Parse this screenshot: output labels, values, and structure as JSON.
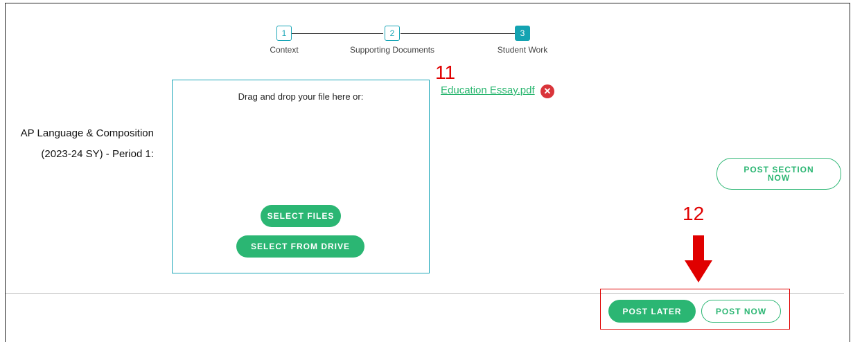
{
  "stepper": {
    "steps": [
      {
        "number": "1",
        "label": "Context"
      },
      {
        "number": "2",
        "label": "Supporting Documents"
      },
      {
        "number": "3",
        "label": "Student Work"
      }
    ]
  },
  "annotations": {
    "upload_marker": "11",
    "post_marker": "12"
  },
  "uploaded_file": {
    "name": "Education Essay.pdf",
    "remove_icon": "close-icon"
  },
  "section": {
    "course_line1": "AP Language & Composition",
    "course_line2": "(2023-24 SY) - Period 1:"
  },
  "dropzone": {
    "instructions": "Drag and drop your file here or:",
    "select_files_label": "SELECT FILES",
    "select_drive_label": "SELECT FROM DRIVE"
  },
  "actions": {
    "post_section_now_label": "POST SECTION NOW",
    "post_later_label": "POST LATER",
    "post_now_label": "POST NOW"
  },
  "colors": {
    "accent": "#2bb673",
    "teal": "#1aa6b7",
    "annotation": "#e00000"
  }
}
